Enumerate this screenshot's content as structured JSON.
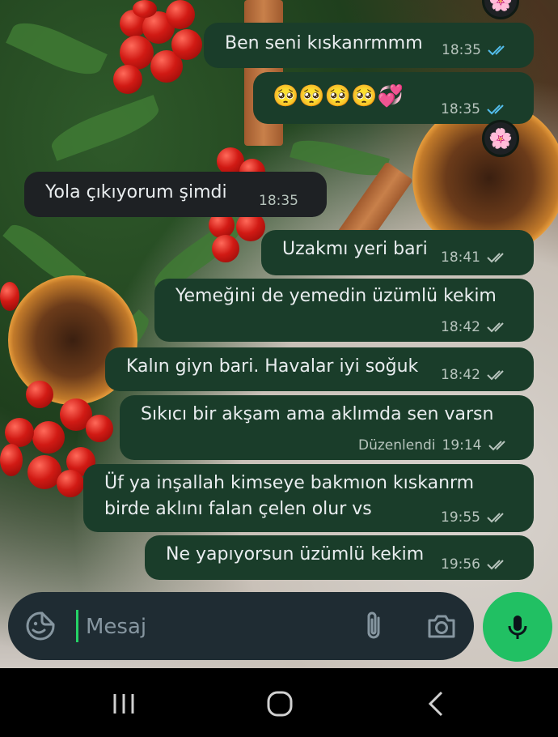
{
  "chat": {
    "messages": [
      {
        "direction": "out",
        "text": "Ben seni kıskanrmmm",
        "time": "18:35",
        "status": "read"
      },
      {
        "direction": "out",
        "text": "🥺🥺🥺🥺💞",
        "time": "18:35",
        "status": "read",
        "reaction": "🌸"
      },
      {
        "direction": "in",
        "text": "Yola çıkıyorum şimdi",
        "time": "18:35"
      },
      {
        "direction": "out",
        "text": "Uzakmı yeri bari",
        "time": "18:41",
        "status": "delivered"
      },
      {
        "direction": "out",
        "text": "Yemeğini de yemedin üzümlü kekim",
        "time": "18:42",
        "status": "delivered"
      },
      {
        "direction": "out",
        "text": "Kalın giyn bari.  Havalar iyi soğuk",
        "time": "18:42",
        "status": "delivered"
      },
      {
        "direction": "out",
        "text": "Sıkıcı bir akşam ama aklımda sen varsn",
        "edited_label": "Düzenlendi",
        "time": "19:14",
        "status": "delivered"
      },
      {
        "direction": "out",
        "text_lines": [
          "Üf ya inşallah kimseye bakmıon kıskanrm",
          "birde aklını falan çelen olur vs"
        ],
        "time": "19:55",
        "status": "delivered"
      },
      {
        "direction": "out",
        "text": "Ne yapıyorsun üzümlü kekim",
        "time": "19:56",
        "status": "delivered"
      }
    ],
    "top_reaction": "🌸"
  },
  "composer": {
    "placeholder": "Mesaj",
    "icons": [
      "emoji-sticker-icon",
      "paperclip-icon",
      "camera-icon",
      "microphone-icon"
    ]
  },
  "navbar": {
    "icons": [
      "recent-apps-icon",
      "home-icon",
      "back-icon"
    ]
  },
  "colors": {
    "outgoing_bubble": "#1a3d2a",
    "incoming_bubble": "#1e2124",
    "read_tick": "#53bdeb",
    "delivered_tick": "#b7c4bd",
    "mic_button": "#21c063"
  }
}
